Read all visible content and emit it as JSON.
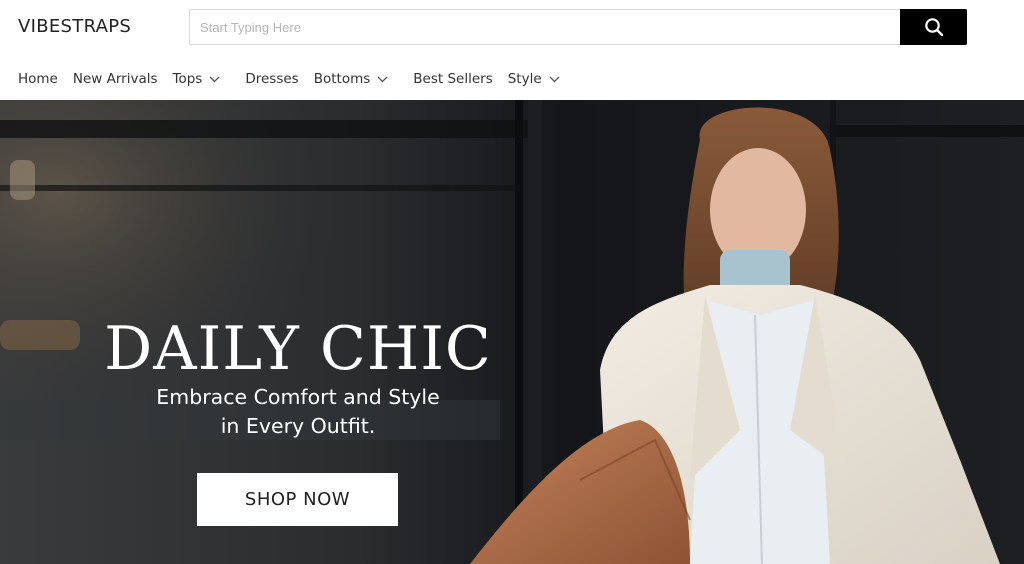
{
  "header": {
    "logo": "VIBESTRAPS",
    "search": {
      "placeholder": "Start Typing Here",
      "button_icon": "search-icon"
    }
  },
  "nav": {
    "items": [
      {
        "label": "Home",
        "has_dropdown": false
      },
      {
        "label": "New Arrivals",
        "has_dropdown": false
      },
      {
        "label": "Tops",
        "has_dropdown": true
      },
      {
        "label": "Dresses",
        "has_dropdown": false
      },
      {
        "label": "Bottoms",
        "has_dropdown": true
      },
      {
        "label": "Best Sellers",
        "has_dropdown": false
      },
      {
        "label": "Style",
        "has_dropdown": true
      }
    ]
  },
  "hero": {
    "title": "DAILY CHIC",
    "subtitle_line1": "Embrace Comfort and Style",
    "subtitle_line2": "in Every Outfit.",
    "cta_label": "SHOP NOW"
  },
  "colors": {
    "search_button_bg": "#000000",
    "text": "#222222",
    "hero_text": "#ffffff"
  }
}
